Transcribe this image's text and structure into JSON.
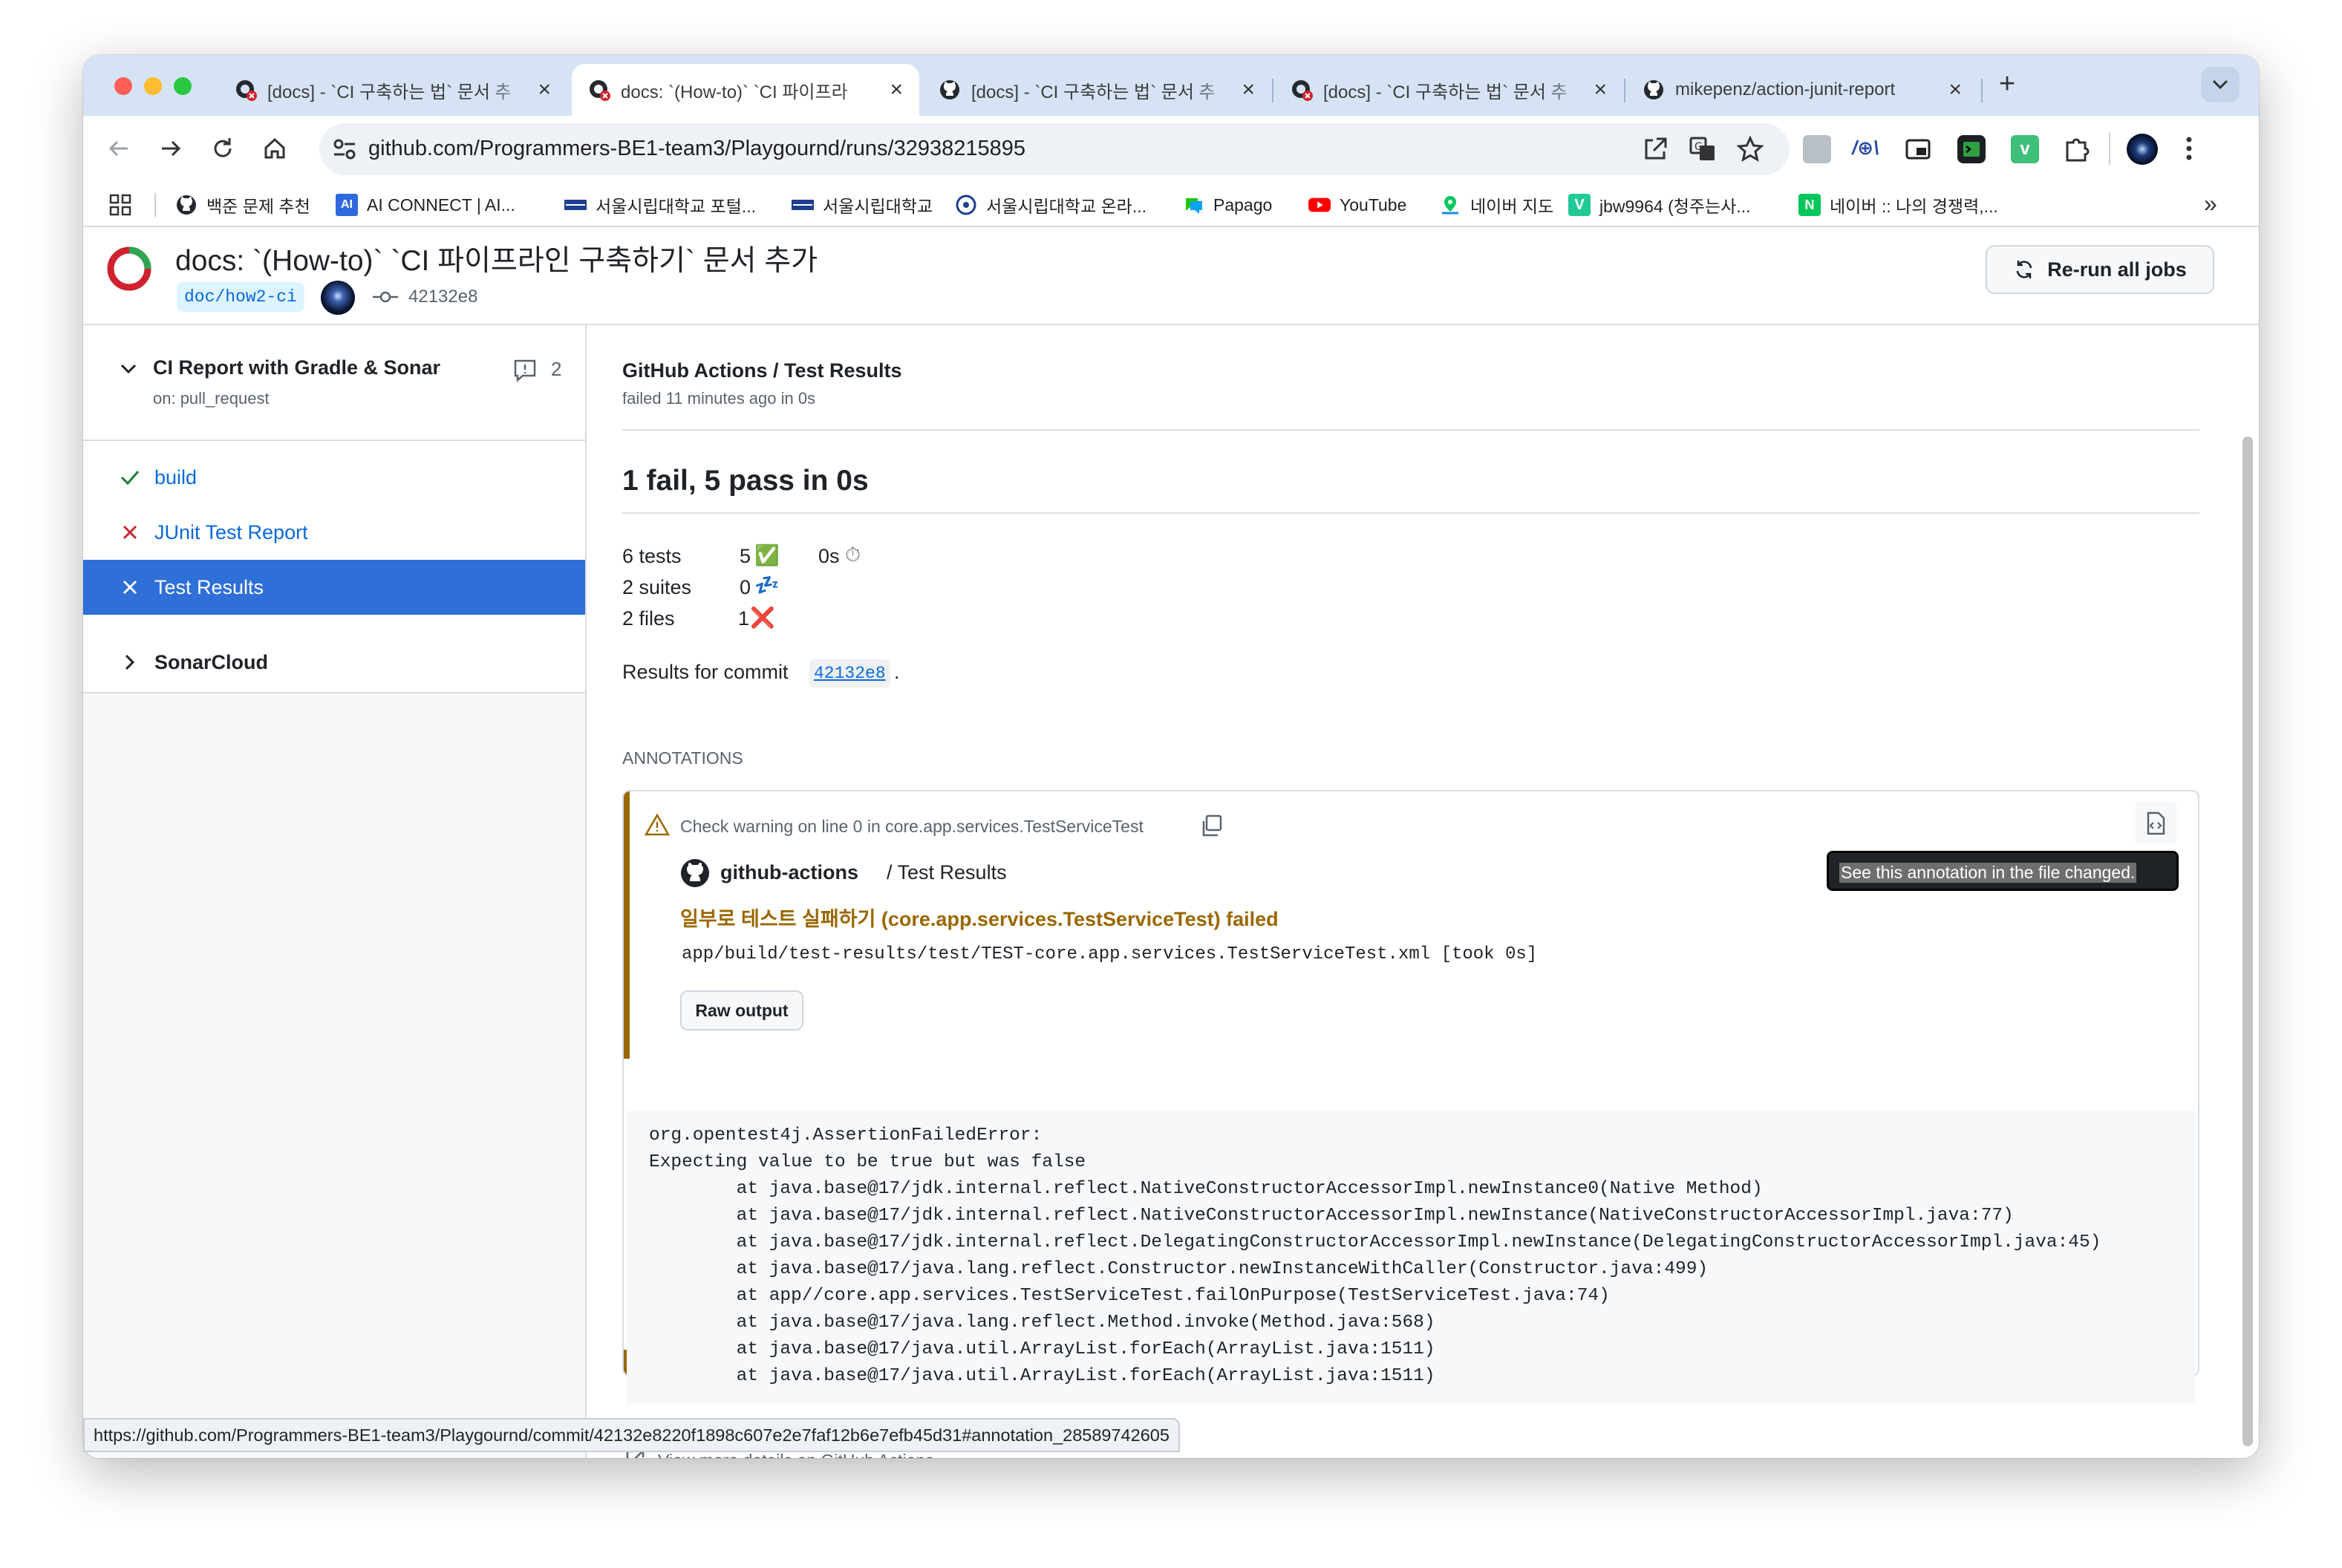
{
  "browser": {
    "tabs": [
      {
        "title": "[docs] - `CI 구축하는 법` 문서 추",
        "icon": "github-fail-icon",
        "active": false
      },
      {
        "title": "docs: `(How-to)` `CI 파이프라",
        "icon": "github-fail-icon",
        "active": true
      },
      {
        "title": "[docs] - `CI 구축하는 법` 문서 추",
        "icon": "github-icon",
        "active": false
      },
      {
        "title": "[docs] - `CI 구축하는 법` 문서 추",
        "icon": "github-fail-icon",
        "active": false
      },
      {
        "title": "mikepenz/action-junit-report",
        "icon": "github-icon",
        "active": false
      }
    ],
    "new_tab": "+",
    "tab_close": "×",
    "url": "github.com/Programmers-BE1-team3/Playgournd/runs/32938215895",
    "bookmarks": [
      {
        "label": "백준 문제 추천",
        "icon": "github-icon"
      },
      {
        "label": "AI CONNECT | AI...",
        "icon": "ai-connect-icon"
      },
      {
        "label": "서울시립대학교 포털...",
        "icon": "uos-icon"
      },
      {
        "label": "서울시립대학교",
        "icon": "uos-icon"
      },
      {
        "label": "서울시립대학교 온라...",
        "icon": "uos-online-icon"
      },
      {
        "label": "Papago",
        "icon": "papago-icon"
      },
      {
        "label": "YouTube",
        "icon": "youtube-icon"
      },
      {
        "label": "네이버 지도",
        "icon": "naver-map-icon"
      },
      {
        "label": "jbw9964 (청주는사...",
        "icon": "velog-icon"
      },
      {
        "label": "네이버 :: 나의 경쟁력,...",
        "icon": "naver-icon"
      }
    ],
    "more_bookmarks": "»",
    "status_url": "https://github.com/Programmers-BE1-team3/Playgournd/commit/42132e8220f1898c607e2e7faf12b6e7efb45d31#annotation_28589742605"
  },
  "header": {
    "title": "docs: `(How-to)` `CI 파이프라인 구축하기` 문서 추가",
    "branch": "doc/how2-ci",
    "commit": "42132e8",
    "rerun_label": "Re-run all jobs"
  },
  "sidebar": {
    "workflow_name": "CI Report with Gradle & Sonar",
    "workflow_trigger": "on: pull_request",
    "comment_count": "2",
    "items": [
      {
        "label": "build",
        "status": "success"
      },
      {
        "label": "JUnit Test Report",
        "status": "failure"
      },
      {
        "label": "Test Results",
        "status": "failure",
        "selected": true
      }
    ],
    "sonar_label": "SonarCloud"
  },
  "main": {
    "check_title": "GitHub Actions / Test Results",
    "check_subtitle": "failed 11 minutes ago in 0s",
    "summary_heading": "1 fail, 5 pass in 0s",
    "stats": {
      "tests": "6 tests",
      "suites": "2 suites",
      "files": "2 files",
      "passed": "5",
      "skipped": "0",
      "failed": "1",
      "duration": "0s",
      "pass_emoji": "✅",
      "skip_emoji": "💤",
      "fail_emoji": "❌",
      "timer_emoji": "⏱"
    },
    "results_prefix": "Results for commit",
    "results_commit": "42132e8",
    "results_suffix": ".",
    "annotations_label": "ANNOTATIONS",
    "annotation": {
      "warning_text": "Check warning on line 0 in core.app.services.TestServiceTest",
      "author": "github-actions",
      "source": "/ Test Results",
      "title": "일부로 테스트 실패하기 (core.app.services.TestServiceTest) failed",
      "path": "app/build/test-results/test/TEST-core.app.services.TestServiceTest.xml [took 0s]",
      "raw_output_label": "Raw output",
      "tooltip": "See this annotation in the file changed.",
      "stack_trace": [
        "org.opentest4j.AssertionFailedError: ",
        "Expecting value to be true but was false",
        "\tat java.base@17/jdk.internal.reflect.NativeConstructorAccessorImpl.newInstance0(Native Method)",
        "\tat java.base@17/jdk.internal.reflect.NativeConstructorAccessorImpl.newInstance(NativeConstructorAccessorImpl.java:77)",
        "\tat java.base@17/jdk.internal.reflect.DelegatingConstructorAccessorImpl.newInstance(DelegatingConstructorAccessorImpl.java:45)",
        "\tat java.base@17/java.lang.reflect.Constructor.newInstanceWithCaller(Constructor.java:499)",
        "\tat app//core.app.services.TestServiceTest.failOnPurpose(TestServiceTest.java:74)",
        "\tat java.base@17/java.lang.reflect.Method.invoke(Method.java:568)",
        "\tat java.base@17/java.util.ArrayList.forEach(ArrayList.java:1511)",
        "\tat java.base@17/java.util.ArrayList.forEach(ArrayList.java:1511)"
      ]
    },
    "view_more_label": "View more details on GitHub Actions"
  },
  "colors": {
    "accent_blue": "#0969da",
    "fail_red": "#cf222e",
    "success_green": "#1a7f37",
    "warning_brown": "#9a6700",
    "selected_bg": "#2f6fd8"
  }
}
